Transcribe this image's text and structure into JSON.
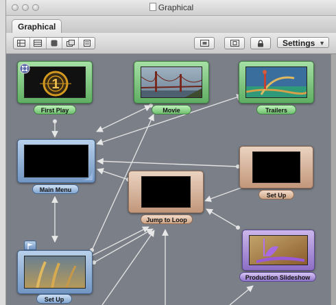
{
  "window": {
    "title": "Graphical",
    "tab": "Graphical"
  },
  "toolbar": {
    "view_buttons": [
      "grid-view-icon",
      "list-view-icon",
      "menu-view-icon",
      "slideshow-view-icon",
      "script-view-icon"
    ],
    "right_buttons": [
      "fit-view-icon",
      "zoom-view-icon",
      "lock-icon"
    ],
    "settings_label": "Settings"
  },
  "nodes": {
    "first_play": {
      "label": "First Play",
      "color": "#5fae63",
      "icon": "film-leader-icon",
      "leader_number": "1"
    },
    "movie": {
      "label": "Movie",
      "color": "#5fae63",
      "icon": "bridge-thumbnail"
    },
    "trailers": {
      "label": "Trailers",
      "color": "#5fae63",
      "icon": "trailers-thumbnail"
    },
    "main_menu": {
      "label": "Main Menu",
      "color": "#7195c2",
      "icon": "menu-thumbnail"
    },
    "set_up_right": {
      "label": "Set Up",
      "color": "#c2977a",
      "icon": "script-thumbnail"
    },
    "jump_to_loop": {
      "label": "Jump to Loop",
      "color": "#c2977a",
      "icon": "script-thumbnail"
    },
    "production_slideshow": {
      "label": "Production Slideshow",
      "color": "#8c6ec5",
      "icon": "slideshow-thumbnail"
    },
    "set_up_bottom": {
      "label": "Set Up",
      "color": "#7195c2",
      "icon": "wheat-thumbnail"
    }
  }
}
